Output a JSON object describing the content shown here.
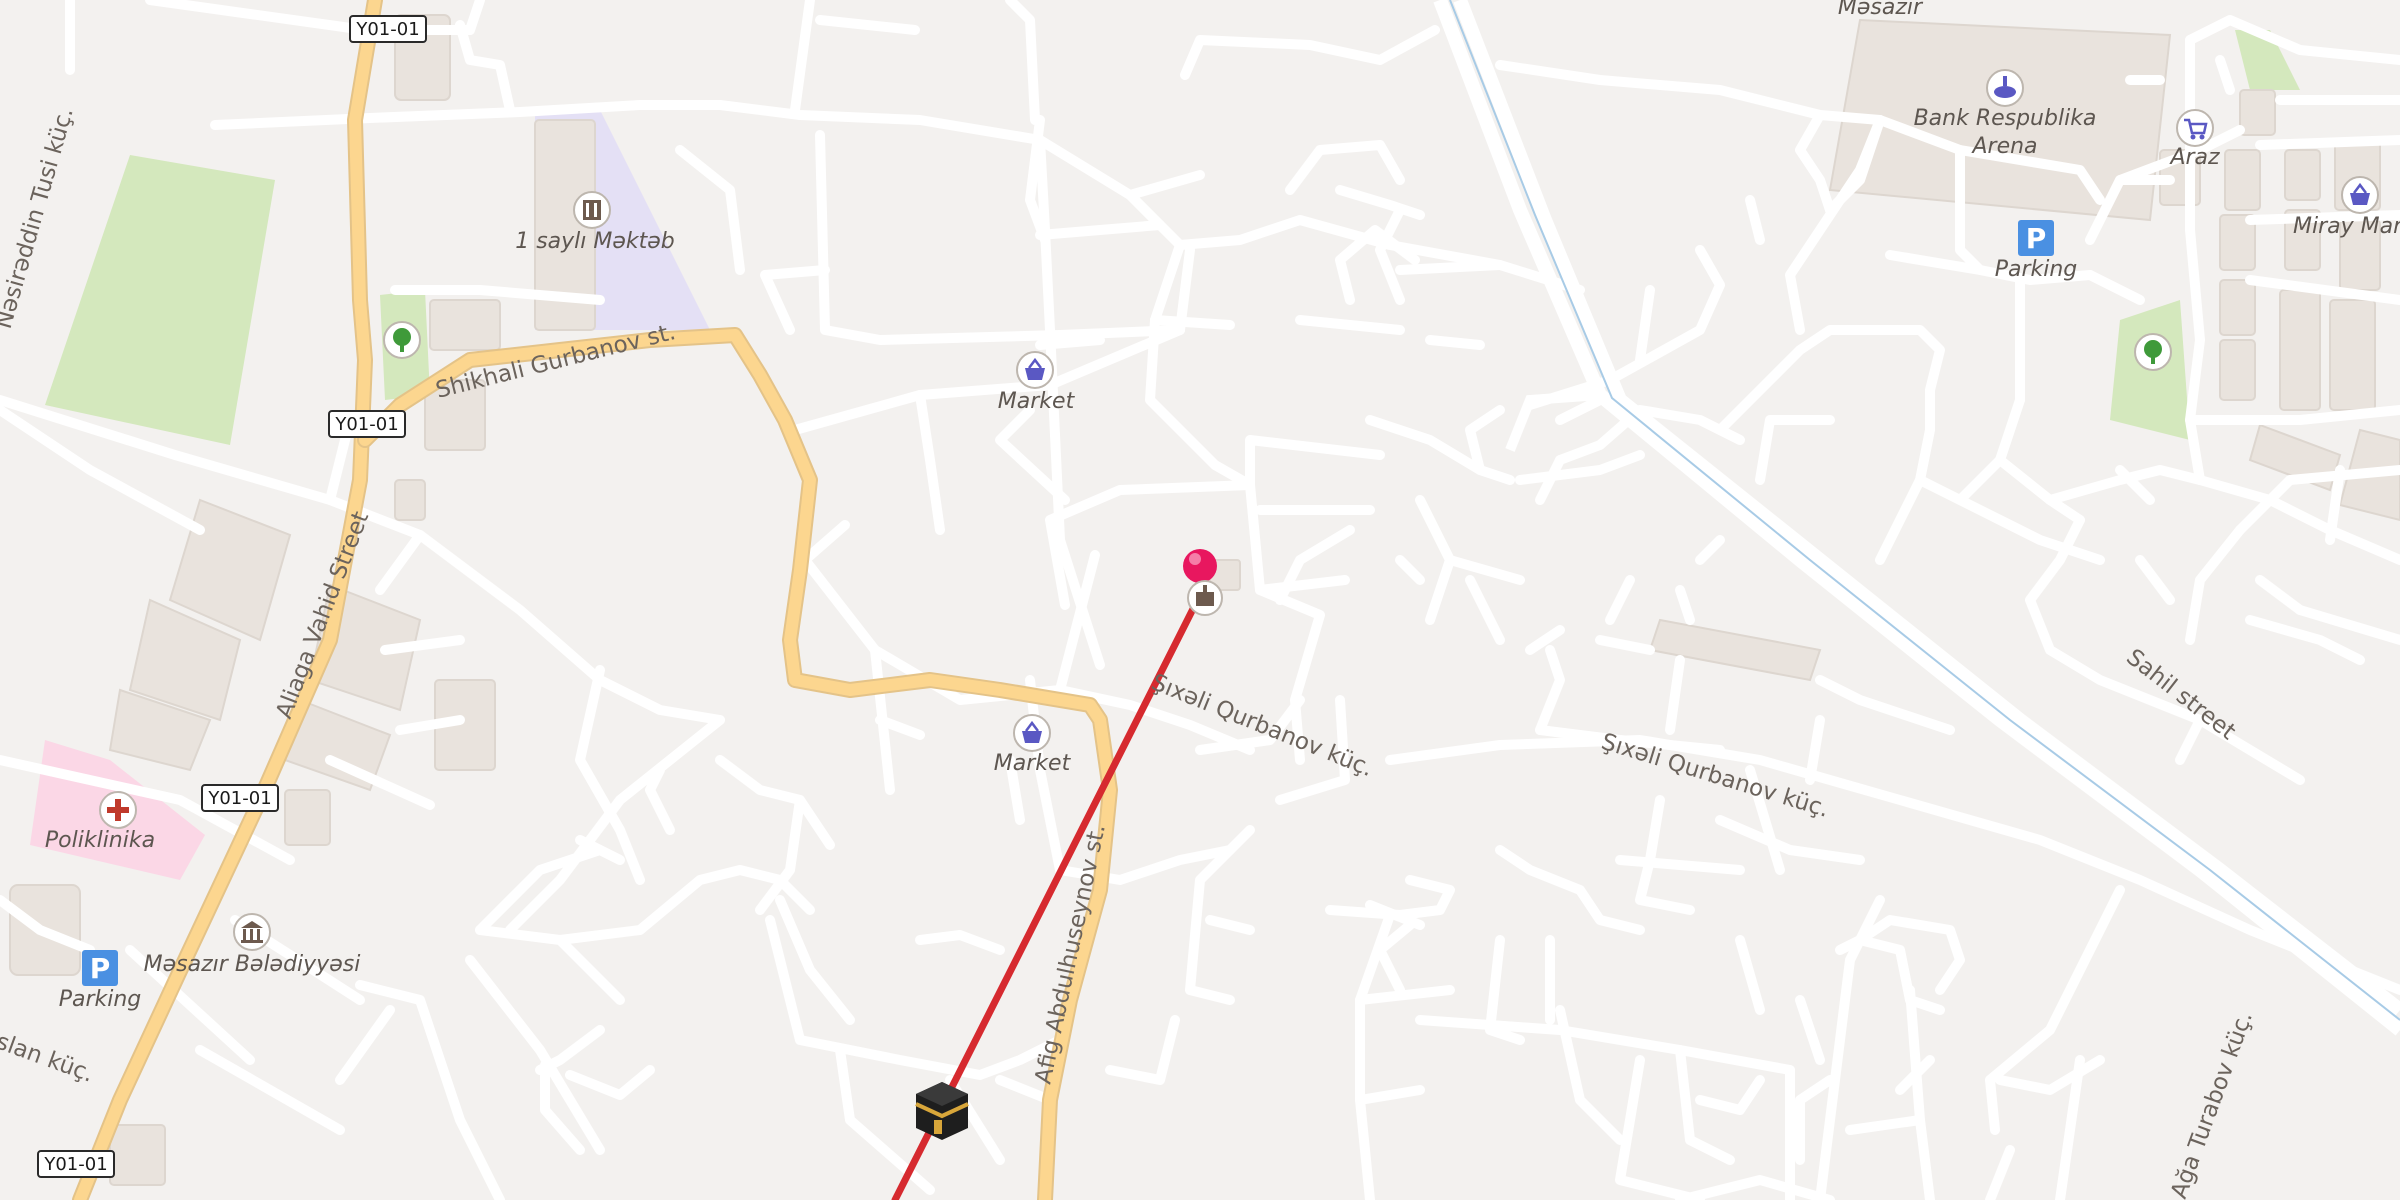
{
  "map": {
    "pois": {
      "school": "1 saylı Məktəb",
      "market_1": "Market",
      "market_2": "Market",
      "arena": "Bank Respublika Arena",
      "arena_line1": "Bank Respublika",
      "arena_line2": "Arena",
      "araz": "Araz",
      "miray": "Miray Mar",
      "parking_1": "Parking",
      "parking_2": "Parking",
      "polyclinic": "Poliklinika",
      "municipality": "Məsazır Bələdiyyəsi",
      "masazir": "Məsazır"
    },
    "streets": {
      "shikhali": "Shikhali Gurbanov st.",
      "aliaga": "Aliaga Vahid Street",
      "sixali_1": "Şıxəli Qurbanov küç.",
      "sixali_2": "Şıxəli Qurbanov küç.",
      "afig": "Afig Abdulhuseynov st.",
      "sahil": "Sahil street",
      "tusi": "Nəsirəddin Tusi küç.",
      "turabov": "Ağa Turabov küç.",
      "aslan": "Aslan küç."
    },
    "shields": [
      "Y01-01",
      "Y01-01",
      "Y01-01",
      "Y01-01"
    ],
    "parking_symbol": "P",
    "colors": {
      "background": "#f3f1ef",
      "road": "#ffffff",
      "main_road": "#fcd68f",
      "route_line": "#d62a2f",
      "pin": "#e8175f",
      "park": "#cfe6b4",
      "poi_blue": "#5a58c3"
    },
    "icons": [
      "kaaba-icon",
      "location-pin-icon",
      "shopping-basket-icon",
      "shopping-cart-icon",
      "parking-icon",
      "tree-icon",
      "hospital-icon",
      "museum-icon",
      "stadium-icon",
      "school-icon",
      "religious-building-icon"
    ]
  }
}
